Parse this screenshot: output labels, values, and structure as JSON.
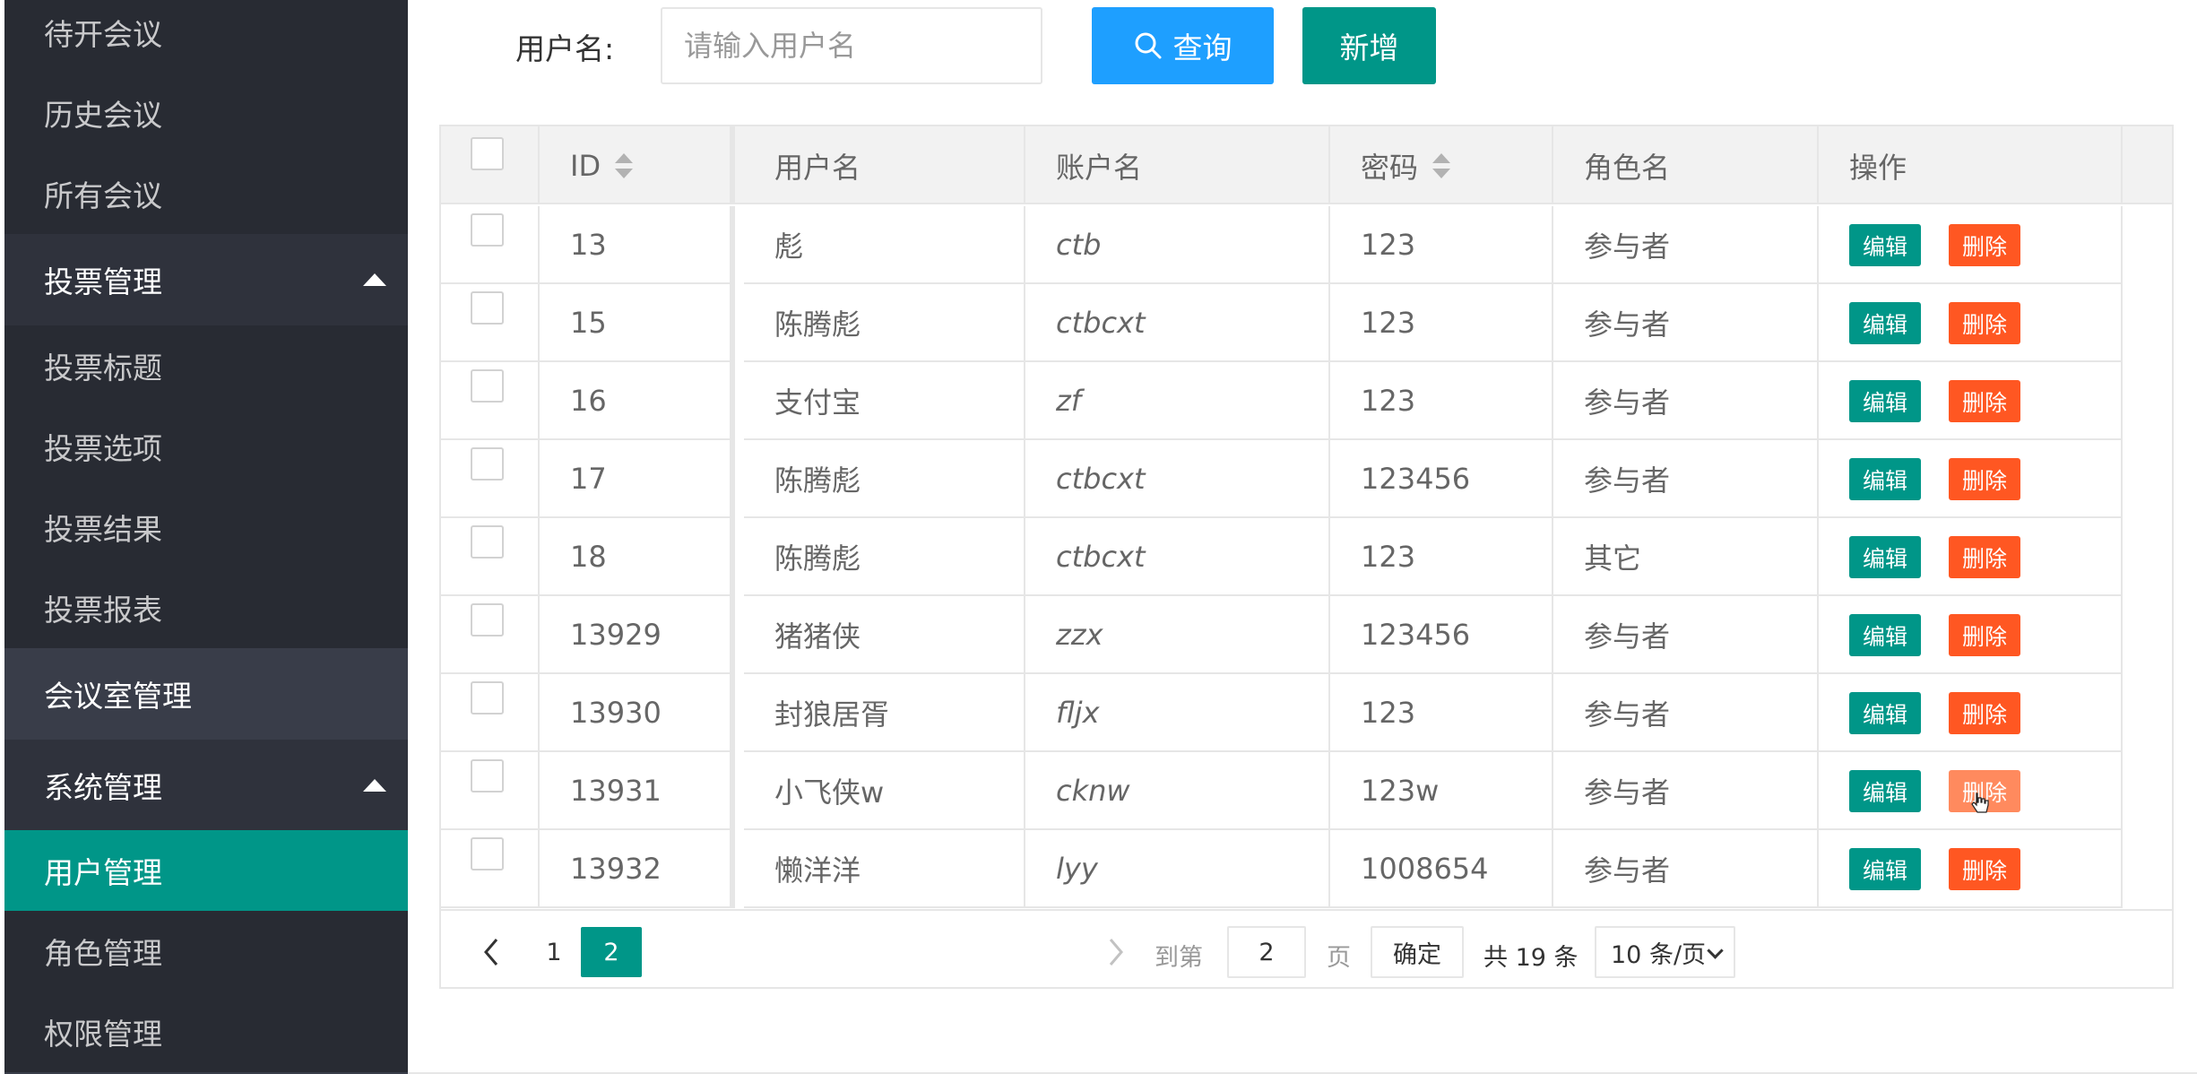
{
  "sidebar": {
    "top_items": [
      "待开会议",
      "历史会议",
      "所有会议"
    ],
    "vote_group": "投票管理",
    "vote_items": [
      "投票标题",
      "投票选项",
      "投票结果",
      "投票报表"
    ],
    "room_group": "会议室管理",
    "system_group": "系统管理",
    "system_items": [
      "用户管理",
      "角色管理",
      "权限管理"
    ],
    "active_item": "用户管理"
  },
  "search": {
    "label": "用户名:",
    "placeholder": "请输入用户名",
    "value": "",
    "query_label": "查询",
    "add_label": "新增"
  },
  "table": {
    "columns": [
      "ID",
      "用户名",
      "账户名",
      "密码",
      "角色名",
      "操作"
    ],
    "edit_label": "编辑",
    "delete_label": "删除",
    "rows": [
      {
        "id": "13",
        "username": "彪",
        "account": "ctb",
        "password": "123",
        "role": "参与者"
      },
      {
        "id": "15",
        "username": "陈腾彪",
        "account": "ctbcxt",
        "password": "123",
        "role": "参与者"
      },
      {
        "id": "16",
        "username": "支付宝",
        "account": "zf",
        "password": "123",
        "role": "参与者"
      },
      {
        "id": "17",
        "username": "陈腾彪",
        "account": "ctbcxt",
        "password": "123456",
        "role": "参与者"
      },
      {
        "id": "18",
        "username": "陈腾彪",
        "account": "ctbcxt",
        "password": "123",
        "role": "其它"
      },
      {
        "id": "13929",
        "username": "猪猪侠",
        "account": "zzx",
        "password": "123456",
        "role": "参与者"
      },
      {
        "id": "13930",
        "username": "封狼居胥",
        "account": "fljx",
        "password": "123",
        "role": "参与者"
      },
      {
        "id": "13931",
        "username": "小飞侠w",
        "account": "cknw",
        "password": "123w",
        "role": "参与者"
      },
      {
        "id": "13932",
        "username": "懒洋洋",
        "account": "lyy",
        "password": "1008654",
        "role": "参与者"
      }
    ]
  },
  "pager": {
    "pages": [
      "1",
      "2"
    ],
    "current": "2",
    "goto_label": "到第",
    "goto_value": "2",
    "page_unit": "页",
    "confirm_label": "确定",
    "total_label": "共 19 条",
    "page_size_label": "10 条/页"
  },
  "colors": {
    "sidebar_bg": "#393d49",
    "sidebar_active": "#009688",
    "primary": "#009688",
    "query_blue": "#1e9fff",
    "danger": "#ff5722"
  }
}
